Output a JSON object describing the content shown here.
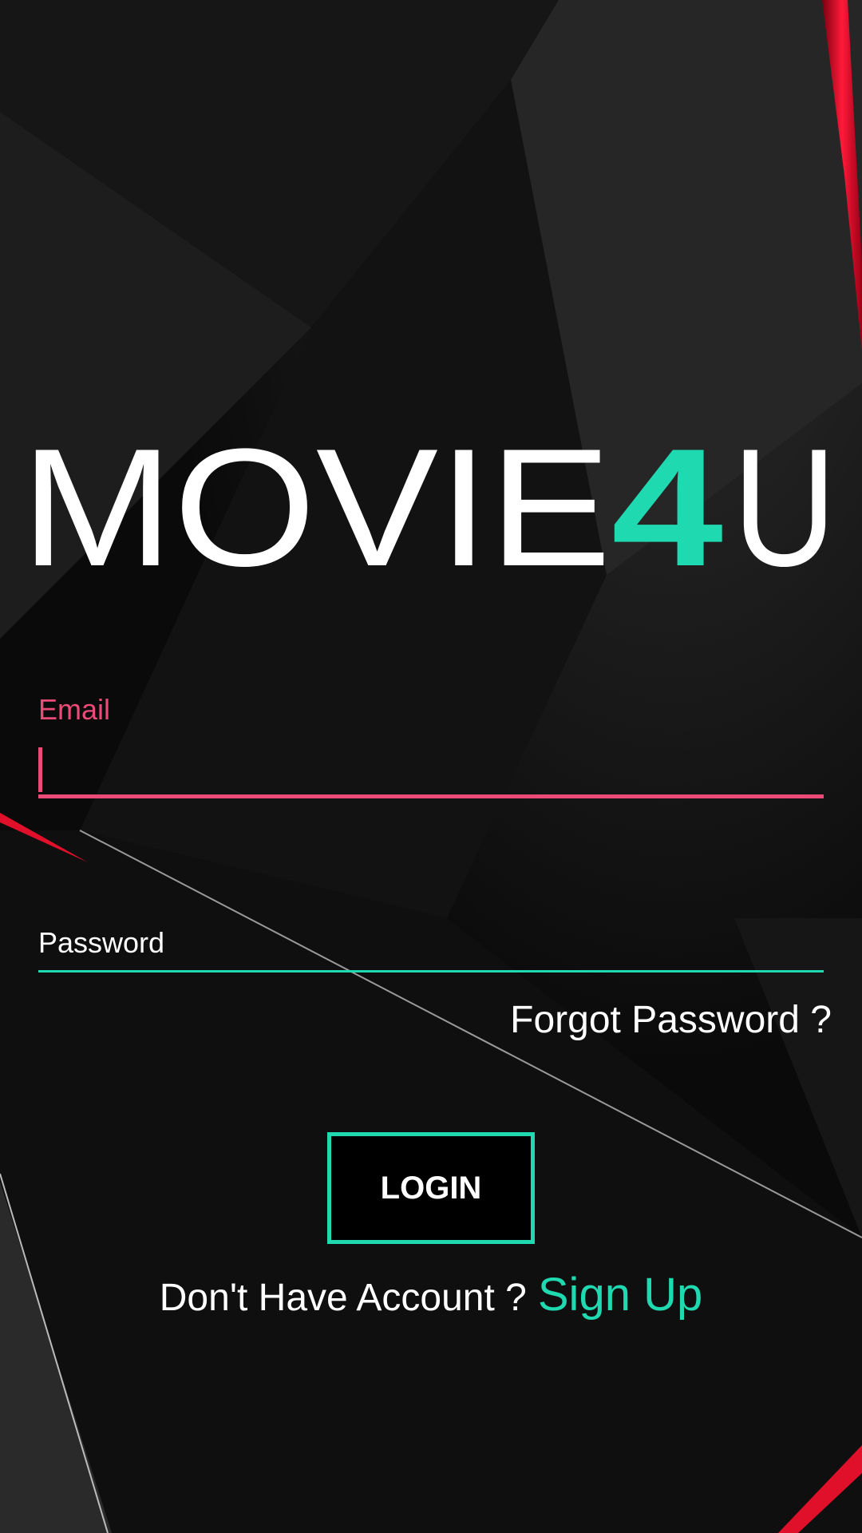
{
  "app": {
    "logo_primary": "MOVIE",
    "logo_accent": "4",
    "logo_suffix": "U"
  },
  "colors": {
    "accent_teal": "#1fd9b0",
    "accent_pink": "#ec4a78",
    "background": "#0b0b0b",
    "edge_red": "#e0102a"
  },
  "form": {
    "email_label": "Email",
    "email_value": "",
    "password_label": "Password",
    "password_value": "",
    "forgot_label": "Forgot Password ?",
    "login_label": "LOGIN"
  },
  "footer": {
    "signup_prompt": "Don't Have Account ?",
    "signup_label": "Sign Up"
  }
}
